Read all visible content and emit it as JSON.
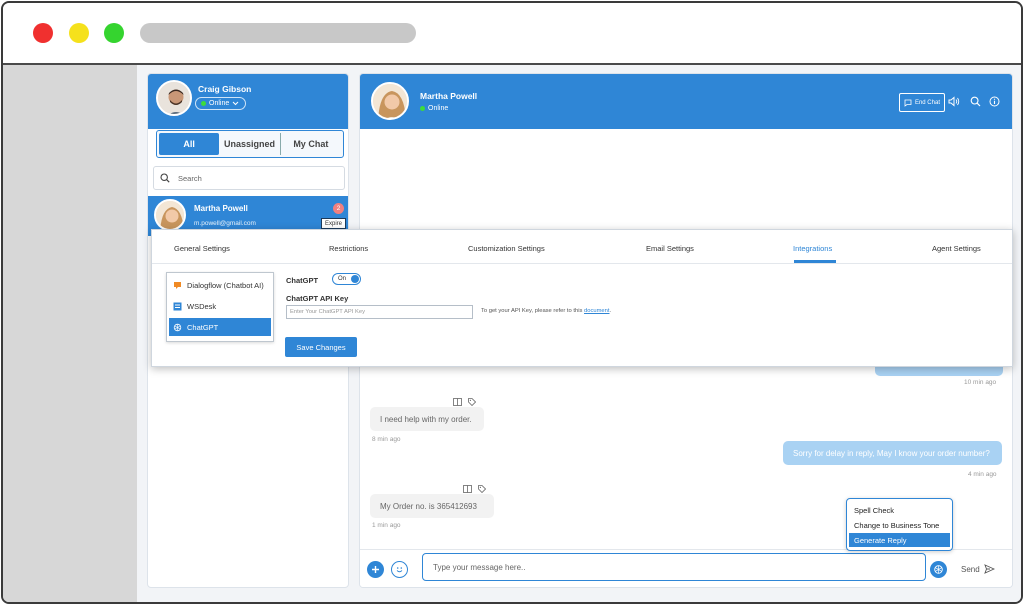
{
  "window": {
    "url": ""
  },
  "agent": {
    "name": "Craig Gibson",
    "status": "Online"
  },
  "tabs": [
    "All",
    "Unassigned",
    "My Chat"
  ],
  "search": {
    "placeholder": "Search"
  },
  "contact": {
    "name": "Martha Powell",
    "email": "m.powell@gmail.com",
    "badge": "2",
    "tag": "Expire"
  },
  "chat_header": {
    "name": "Martha Powell",
    "status": "Online",
    "end_chat": "End Chat"
  },
  "messages": [
    {
      "text": "I need help with my order.",
      "time": "8 min ago",
      "dir": "in"
    },
    {
      "text": "Sorry for delay in reply, May I know your order number?",
      "time": "4 min ago",
      "dir": "out"
    },
    {
      "text": "My Order no. is 365412693",
      "time": "1 min ago",
      "dir": "in"
    }
  ],
  "earlier_time": "10 min ago",
  "composer": {
    "placeholder": "Type your message here..",
    "send": "Send"
  },
  "ai_menu": [
    "Spell Check",
    "Change to Business Tone",
    "Generate Reply"
  ],
  "settings": {
    "tabs": [
      "General Settings",
      "Restrictions",
      "Customization Settings",
      "Email Settings",
      "Integrations",
      "Agent Settings"
    ],
    "active_tab": "Integrations",
    "integrations": [
      "Dialogflow (Chatbot AI)",
      "WSDesk",
      "ChatGPT"
    ],
    "chatgpt_label": "ChatGPT",
    "toggle": "On",
    "api_key_label": "ChatGPT API Key",
    "api_key_placeholder": "Enter Your ChatGPT API Key",
    "hint_text": "To get your API Key, please refer to this",
    "hint_link": "document",
    "hint_end": ".",
    "save": "Save Changes"
  },
  "colors": {
    "primary": "#2f86d6",
    "online": "#3ddc3a",
    "out_bubble": "#a9d2f3"
  }
}
